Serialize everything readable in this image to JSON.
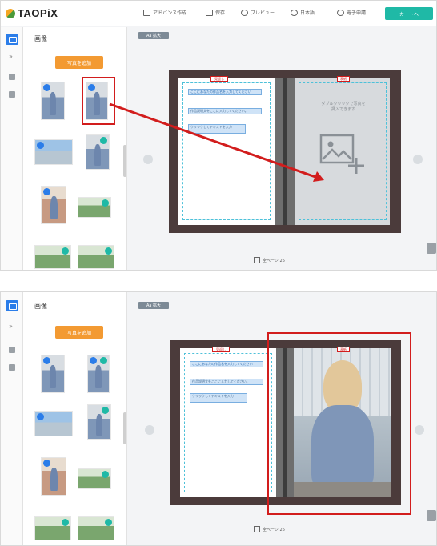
{
  "header": {
    "logo": "TAOPiX",
    "nav": [
      {
        "label": "アドバンス作成",
        "icon": "edit-icon"
      },
      {
        "label": "保存",
        "icon": "save-icon"
      },
      {
        "label": "プレビュー",
        "icon": "preview-icon"
      },
      {
        "label": "日本語",
        "icon": "language-icon"
      },
      {
        "label": "電子申請",
        "icon": "user-icon"
      }
    ],
    "order_button": "カートへ"
  },
  "sidebar": {
    "title": "画像",
    "upload_button": "写真を追加"
  },
  "canvas": {
    "zoom_label": "Aa 拡大",
    "left_page_tag": "見返し",
    "right_page_tag": "表紙",
    "text_blocks": [
      "ここにあなたの作品名を入力してください",
      "作品説明文をここに入力してください。",
      "クリックしてテキストを入力"
    ],
    "drop_hint_line1": "ダブルクリックで写真を",
    "drop_hint_line2": "挿入できます",
    "page_count_label": "全ページ 26"
  },
  "colors": {
    "accent_teal": "#1fb9a6",
    "accent_blue": "#2b7de9",
    "accent_orange": "#f39a32",
    "annotation_red": "#d21d1d"
  }
}
